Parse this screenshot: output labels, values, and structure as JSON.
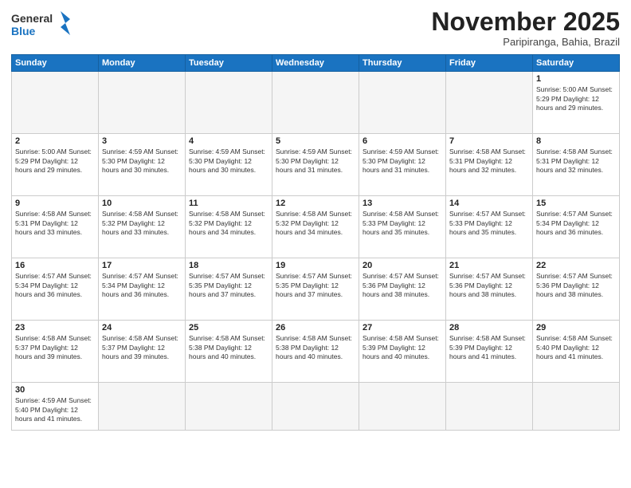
{
  "logo": {
    "text_general": "General",
    "text_blue": "Blue"
  },
  "header": {
    "month_title": "November 2025",
    "subtitle": "Paripiranga, Bahia, Brazil"
  },
  "weekdays": [
    "Sunday",
    "Monday",
    "Tuesday",
    "Wednesday",
    "Thursday",
    "Friday",
    "Saturday"
  ],
  "weeks": [
    [
      {
        "day": "",
        "empty": true
      },
      {
        "day": "",
        "empty": true
      },
      {
        "day": "",
        "empty": true
      },
      {
        "day": "",
        "empty": true
      },
      {
        "day": "",
        "empty": true
      },
      {
        "day": "",
        "empty": true
      },
      {
        "day": "1",
        "info": "Sunrise: 5:00 AM\nSunset: 5:29 PM\nDaylight: 12 hours and 29 minutes."
      }
    ],
    [
      {
        "day": "2",
        "info": "Sunrise: 5:00 AM\nSunset: 5:29 PM\nDaylight: 12 hours and 29 minutes."
      },
      {
        "day": "3",
        "info": "Sunrise: 4:59 AM\nSunset: 5:30 PM\nDaylight: 12 hours and 30 minutes."
      },
      {
        "day": "4",
        "info": "Sunrise: 4:59 AM\nSunset: 5:30 PM\nDaylight: 12 hours and 30 minutes."
      },
      {
        "day": "5",
        "info": "Sunrise: 4:59 AM\nSunset: 5:30 PM\nDaylight: 12 hours and 31 minutes."
      },
      {
        "day": "6",
        "info": "Sunrise: 4:59 AM\nSunset: 5:30 PM\nDaylight: 12 hours and 31 minutes."
      },
      {
        "day": "7",
        "info": "Sunrise: 4:58 AM\nSunset: 5:31 PM\nDaylight: 12 hours and 32 minutes."
      },
      {
        "day": "8",
        "info": "Sunrise: 4:58 AM\nSunset: 5:31 PM\nDaylight: 12 hours and 32 minutes."
      }
    ],
    [
      {
        "day": "9",
        "info": "Sunrise: 4:58 AM\nSunset: 5:31 PM\nDaylight: 12 hours and 33 minutes."
      },
      {
        "day": "10",
        "info": "Sunrise: 4:58 AM\nSunset: 5:32 PM\nDaylight: 12 hours and 33 minutes."
      },
      {
        "day": "11",
        "info": "Sunrise: 4:58 AM\nSunset: 5:32 PM\nDaylight: 12 hours and 34 minutes."
      },
      {
        "day": "12",
        "info": "Sunrise: 4:58 AM\nSunset: 5:32 PM\nDaylight: 12 hours and 34 minutes."
      },
      {
        "day": "13",
        "info": "Sunrise: 4:58 AM\nSunset: 5:33 PM\nDaylight: 12 hours and 35 minutes."
      },
      {
        "day": "14",
        "info": "Sunrise: 4:57 AM\nSunset: 5:33 PM\nDaylight: 12 hours and 35 minutes."
      },
      {
        "day": "15",
        "info": "Sunrise: 4:57 AM\nSunset: 5:34 PM\nDaylight: 12 hours and 36 minutes."
      }
    ],
    [
      {
        "day": "16",
        "info": "Sunrise: 4:57 AM\nSunset: 5:34 PM\nDaylight: 12 hours and 36 minutes."
      },
      {
        "day": "17",
        "info": "Sunrise: 4:57 AM\nSunset: 5:34 PM\nDaylight: 12 hours and 36 minutes."
      },
      {
        "day": "18",
        "info": "Sunrise: 4:57 AM\nSunset: 5:35 PM\nDaylight: 12 hours and 37 minutes."
      },
      {
        "day": "19",
        "info": "Sunrise: 4:57 AM\nSunset: 5:35 PM\nDaylight: 12 hours and 37 minutes."
      },
      {
        "day": "20",
        "info": "Sunrise: 4:57 AM\nSunset: 5:36 PM\nDaylight: 12 hours and 38 minutes."
      },
      {
        "day": "21",
        "info": "Sunrise: 4:57 AM\nSunset: 5:36 PM\nDaylight: 12 hours and 38 minutes."
      },
      {
        "day": "22",
        "info": "Sunrise: 4:57 AM\nSunset: 5:36 PM\nDaylight: 12 hours and 38 minutes."
      }
    ],
    [
      {
        "day": "23",
        "info": "Sunrise: 4:58 AM\nSunset: 5:37 PM\nDaylight: 12 hours and 39 minutes."
      },
      {
        "day": "24",
        "info": "Sunrise: 4:58 AM\nSunset: 5:37 PM\nDaylight: 12 hours and 39 minutes."
      },
      {
        "day": "25",
        "info": "Sunrise: 4:58 AM\nSunset: 5:38 PM\nDaylight: 12 hours and 40 minutes."
      },
      {
        "day": "26",
        "info": "Sunrise: 4:58 AM\nSunset: 5:38 PM\nDaylight: 12 hours and 40 minutes."
      },
      {
        "day": "27",
        "info": "Sunrise: 4:58 AM\nSunset: 5:39 PM\nDaylight: 12 hours and 40 minutes."
      },
      {
        "day": "28",
        "info": "Sunrise: 4:58 AM\nSunset: 5:39 PM\nDaylight: 12 hours and 41 minutes."
      },
      {
        "day": "29",
        "info": "Sunrise: 4:58 AM\nSunset: 5:40 PM\nDaylight: 12 hours and 41 minutes."
      }
    ],
    [
      {
        "day": "30",
        "info": "Sunrise: 4:59 AM\nSunset: 5:40 PM\nDaylight: 12 hours and 41 minutes."
      },
      {
        "day": "",
        "empty": true
      },
      {
        "day": "",
        "empty": true
      },
      {
        "day": "",
        "empty": true
      },
      {
        "day": "",
        "empty": true
      },
      {
        "day": "",
        "empty": true
      },
      {
        "day": "",
        "empty": true
      }
    ]
  ]
}
